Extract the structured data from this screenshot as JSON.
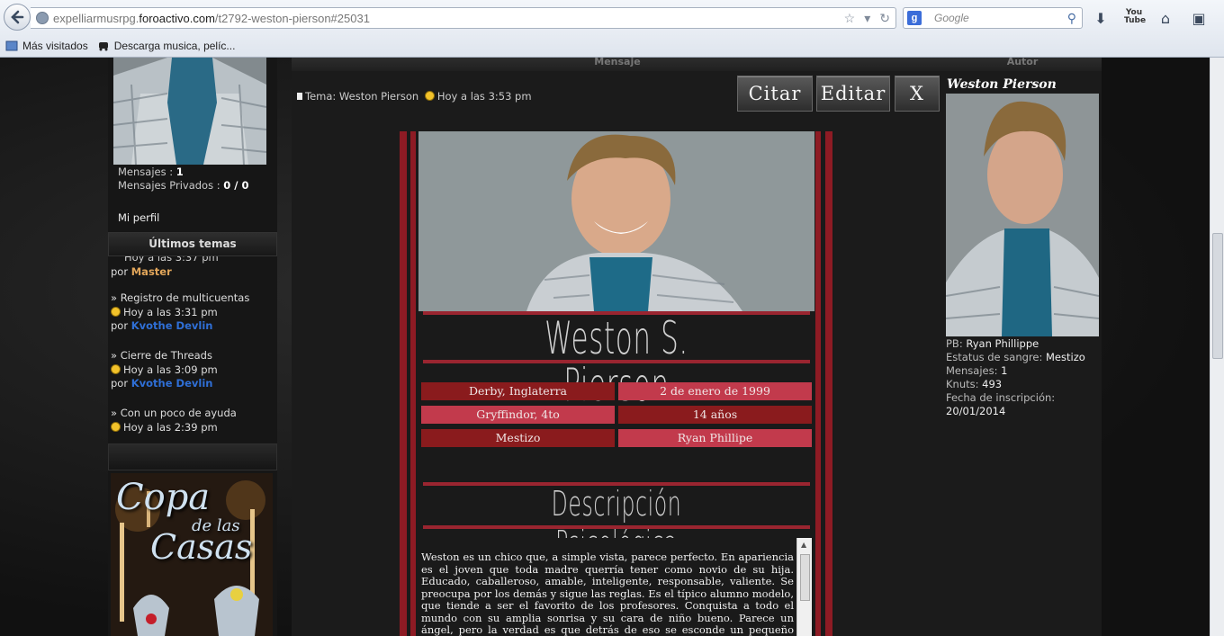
{
  "browser": {
    "url_prefix": "expelliarmusrpg.",
    "url_domain": "foroactivo.com",
    "url_path": "/t2792-weston-pierson#25031",
    "search_placeholder": "Google",
    "bookmarks": [
      "Más visitados",
      "Descarga musica, pelíc..."
    ]
  },
  "sidebar": {
    "messages_label": "Mensajes :",
    "messages_value": "1",
    "private_label": "Mensajes Privados :",
    "private_value": "0 / 0",
    "profile_link": "Mi perfil",
    "latest_heading": "Últimos temas",
    "topics": [
      {
        "title": "",
        "time": "Hoy a las 3:37 pm",
        "by": "por",
        "user": "Master"
      },
      {
        "title": "» Registro de multicuentas",
        "time": "Hoy a las 3:31 pm",
        "by": "por",
        "user": "Kvothe Devlin"
      },
      {
        "title": "» Cierre de Threads",
        "time": "Hoy a las 3:09 pm",
        "by": "por",
        "user": "Kvothe Devlin"
      },
      {
        "title": "» Con un poco de ayuda",
        "time": "Hoy a las 2:39 pm",
        "by": "",
        "user": ""
      }
    ],
    "banner_line1": "Copa",
    "banner_line2": "de las",
    "banner_line3": "Casas"
  },
  "post": {
    "col_head": "Mensaje",
    "topic_label": "Tema: Weston Pierson",
    "time": "Hoy a las 3:53 pm",
    "buttons": {
      "quote": "Citar",
      "edit": "Editar",
      "delete": "X"
    },
    "sheet": {
      "name": "Weston S. Pierson",
      "info": [
        [
          "Derby, Inglaterra",
          "2 de enero de 1999"
        ],
        [
          "Gryffindor, 4to",
          "14 años"
        ],
        [
          "Mestizo",
          "Ryan Phillipe"
        ]
      ],
      "section_title": "Descripción Psicológica",
      "description": "Weston es un chico que, a simple vista, parece perfecto. En apariencia es el joven que toda madre querría tener como novio de su hija. Educado, caballeroso, amable, inteligente, responsable, valiente. Se preocupa por los demás y sigue las reglas. Es el típico alumno modelo, que tiende a ser el favorito de los profesores. Conquista a todo el mundo con su amplia sonrisa y su cara de niño bueno. Parece un ángel, pero la verdad es que detrás de eso se esconde un pequeño demonio."
    }
  },
  "author": {
    "col_head": "Autor",
    "name": "Weston Pierson",
    "stats": [
      {
        "label": "PB: ",
        "value": "Ryan Phillippe"
      },
      {
        "label": "Estatus de sangre: ",
        "value": "Mestizo"
      },
      {
        "label": "Mensajes: ",
        "value": "1"
      },
      {
        "label": "Knuts: ",
        "value": "493"
      },
      {
        "label": "Fecha de inscripción:",
        "value": ""
      },
      {
        "label": "",
        "value": "20/01/2014"
      }
    ]
  },
  "colors": {
    "accent_red": "#8e1b24",
    "cell_dark": "#8a1b1d",
    "cell_light": "#c23a4c",
    "link_blue": "#2f6fd6",
    "master_orange": "#e2a65a"
  }
}
